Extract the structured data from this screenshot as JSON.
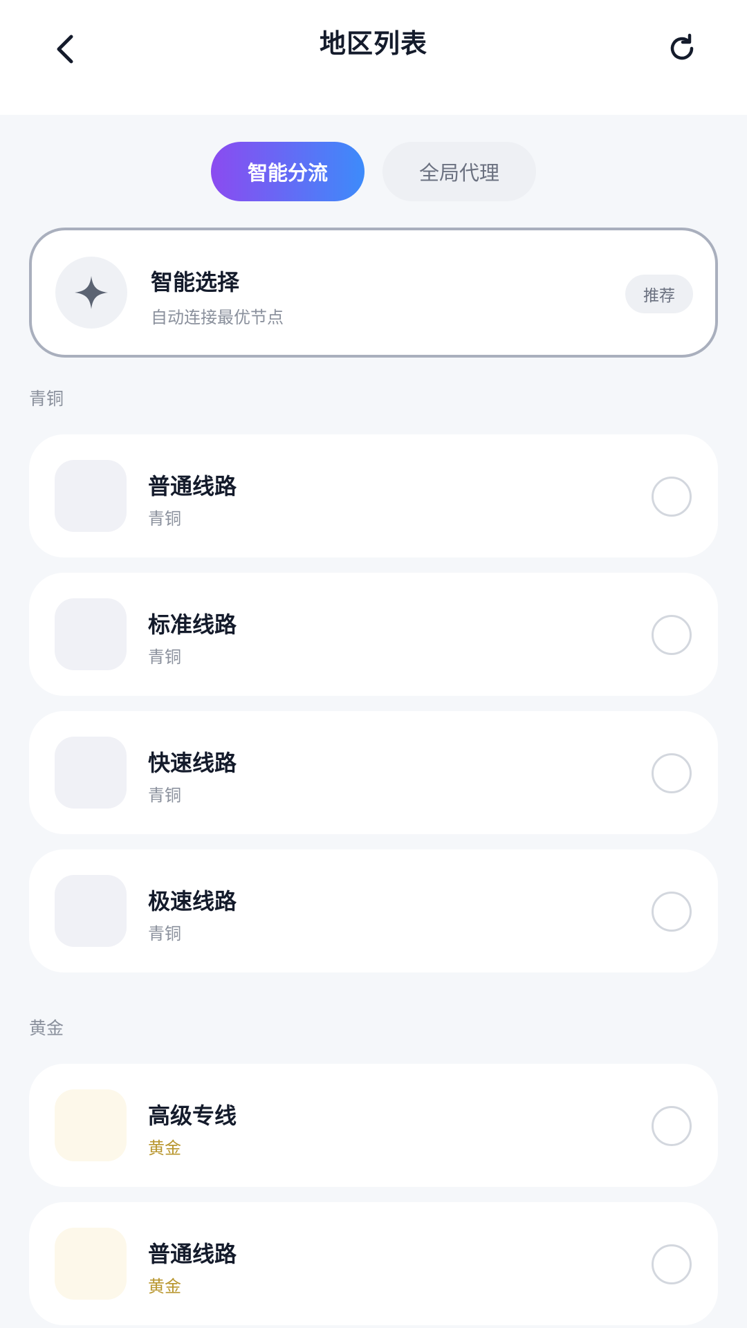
{
  "header": {
    "title": "地区列表",
    "back_icon": "chevron-left-icon",
    "refresh_icon": "refresh-icon"
  },
  "tabs": [
    {
      "label": "智能分流",
      "active": true
    },
    {
      "label": "全局代理",
      "active": false
    }
  ],
  "smart_select": {
    "title": "智能选择",
    "subtitle": "自动连接最优节点",
    "badge": "推荐",
    "icon": "sparkle-icon"
  },
  "sections": [
    {
      "label": "青铜",
      "items": [
        {
          "title": "普通线路",
          "tier": "青铜"
        },
        {
          "title": "标准线路",
          "tier": "青铜"
        },
        {
          "title": "快速线路",
          "tier": "青铜"
        },
        {
          "title": "极速线路",
          "tier": "青铜"
        }
      ]
    },
    {
      "label": "黄金",
      "items": [
        {
          "title": "高级专线",
          "tier": "黄金"
        },
        {
          "title": "普通线路",
          "tier": "黄金"
        }
      ]
    }
  ],
  "colors": {
    "accent_gradient_start": "#8b4bf0",
    "accent_gradient_end": "#3d8bfa",
    "gold_text": "#b8962e",
    "background": "#f5f7fa"
  }
}
